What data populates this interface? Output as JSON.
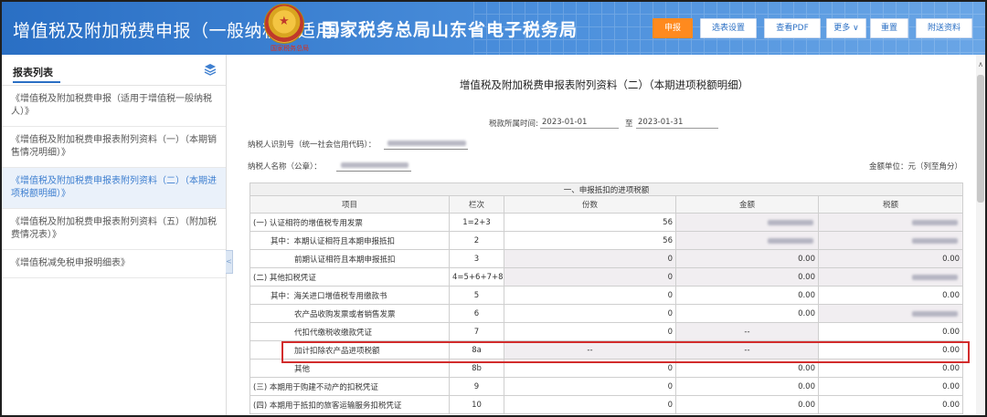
{
  "header": {
    "app_title": "增值税及附加税费申报（一般纳税人适用）",
    "emblem_caption": "国家税务总局",
    "bureau_title": "国家税务总局山东省电子税务局",
    "buttons": {
      "declare": "申报",
      "select_form": "选表设置",
      "view_pdf": "查看PDF",
      "more": "更多",
      "reset": "重置",
      "attach": "附送资料"
    },
    "colors": {
      "primary_button": "#ff8a1e",
      "header_blue": "#2a6fc4"
    }
  },
  "sidebar": {
    "title": "报表列表",
    "items": [
      {
        "label": "《增值税及附加税费申报（适用于增值税一般纳税人）》"
      },
      {
        "label": "《增值税及附加税费申报表附列资料（一）（本期销售情况明细）》"
      },
      {
        "label": "《增值税及附加税费申报表附列资料（二）（本期进项税额明细）》"
      },
      {
        "label": "《增值税及附加税费申报表附列资料（五）（附加税费情况表）》"
      },
      {
        "label": "《增值税减免税申报明细表》"
      }
    ],
    "collapse_glyph": "<"
  },
  "main": {
    "report_title": "增值税及附加税费申报表附列资料（二）（本期进项税额明细）",
    "period_label": "税款所属时间:",
    "period_start": "2023-01-01",
    "period_to": "至",
    "period_end": "2023-01-31",
    "taxpayer_id_label": "纳税人识别号（统一社会信用代码）：",
    "taxpayer_name_label": "纳税人名称（公章）：",
    "unit_label": "金额单位：元（列至角分）",
    "section_title": "一、申报抵扣的进项税额",
    "columns": [
      "项目",
      "栏次",
      "份数",
      "金额",
      "税额"
    ],
    "rows": [
      {
        "item": "(一) 认证相符的增值税专用发票",
        "line": "1=2+3",
        "count": "56",
        "amount": "",
        "tax": ""
      },
      {
        "item": "其中：本期认证相符且本期申报抵扣",
        "line": "2",
        "count": "56",
        "amount": "",
        "tax": ""
      },
      {
        "item": "前期认证相符且本期申报抵扣",
        "line": "3",
        "count": "0",
        "amount": "0.00",
        "tax": "0.00"
      },
      {
        "item": "(二) 其他扣税凭证",
        "line": "4=5+6+7+8",
        "count": "0",
        "amount": "0.00",
        "tax": ""
      },
      {
        "item": "其中：海关进口增值税专用缴款书",
        "line": "5",
        "count": "0",
        "amount": "0.00",
        "tax": "0.00"
      },
      {
        "item": "农产品收购发票或者销售发票",
        "line": "6",
        "count": "0",
        "amount": "0.00",
        "tax": ""
      },
      {
        "item": "代扣代缴税收缴款凭证",
        "line": "7",
        "count": "0",
        "amount": "--",
        "tax": "0.00"
      },
      {
        "item": "加计扣除农产品进项税额",
        "line": "8a",
        "count": "--",
        "amount": "--",
        "tax": "0.00"
      },
      {
        "item": "其他",
        "line": "8b",
        "count": "0",
        "amount": "0.00",
        "tax": "0.00"
      },
      {
        "item": "(三) 本期用于购建不动产的扣税凭证",
        "line": "9",
        "count": "0",
        "amount": "0.00",
        "tax": "0.00"
      },
      {
        "item": "(四) 本期用于抵扣的旅客运输服务扣税凭证",
        "line": "10",
        "count": "0",
        "amount": "0.00",
        "tax": "0.00"
      }
    ]
  }
}
